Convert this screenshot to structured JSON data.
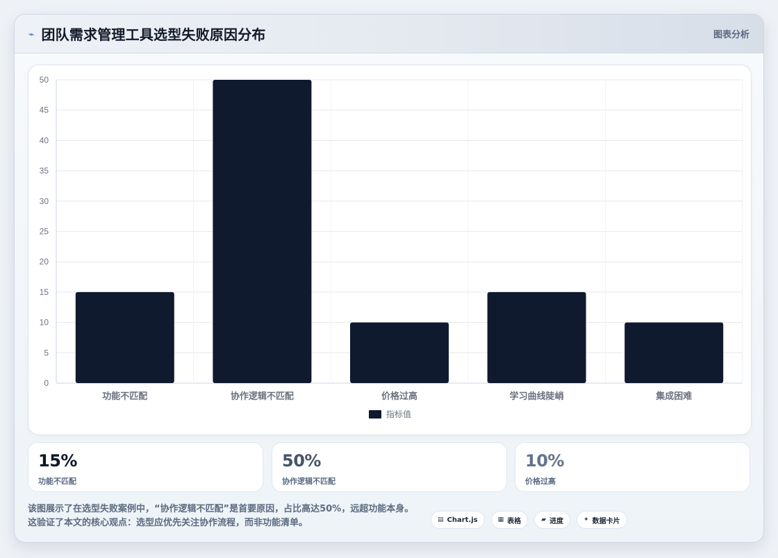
{
  "header": {
    "title": "团队需求管理工具选型失败原因分布",
    "link": "图表分析",
    "icon": "spark-icon"
  },
  "chart_data": {
    "type": "bar",
    "categories": [
      "功能不匹配",
      "协作逻辑不匹配",
      "价格过高",
      "学习曲线陡峭",
      "集成困难"
    ],
    "series": [
      {
        "name": "指标值",
        "values": [
          15,
          50,
          10,
          15,
          10
        ],
        "color": "#0f1a2e"
      }
    ],
    "y_ticks": [
      0,
      5,
      10,
      15,
      20,
      25,
      30,
      35,
      40,
      45,
      50
    ],
    "ylim": [
      0,
      50
    ],
    "grid": true,
    "legend_position": "bottom-center",
    "title": "",
    "xlabel": "",
    "ylabel": ""
  },
  "stats": [
    {
      "value": "15%",
      "label": "功能不匹配",
      "color": "#0f172a"
    },
    {
      "value": "50%",
      "label": "协作逻辑不匹配",
      "color": "#475569"
    },
    {
      "value": "10%",
      "label": "价格过高",
      "color": "#64748b"
    }
  ],
  "footer": {
    "description": "该图展示了在选型失败案例中，“协作逻辑不匹配”是首要原因，占比高达50%，远超功能本身。这验证了本文的核心观点：选型应优先关注协作流程，而非功能清单。",
    "tags": [
      {
        "icon": "▤",
        "label": "Chart.js"
      },
      {
        "icon": "▦",
        "label": "表格"
      },
      {
        "icon": "▰",
        "label": "进度"
      },
      {
        "icon": "✦",
        "label": "数据卡片"
      }
    ]
  }
}
